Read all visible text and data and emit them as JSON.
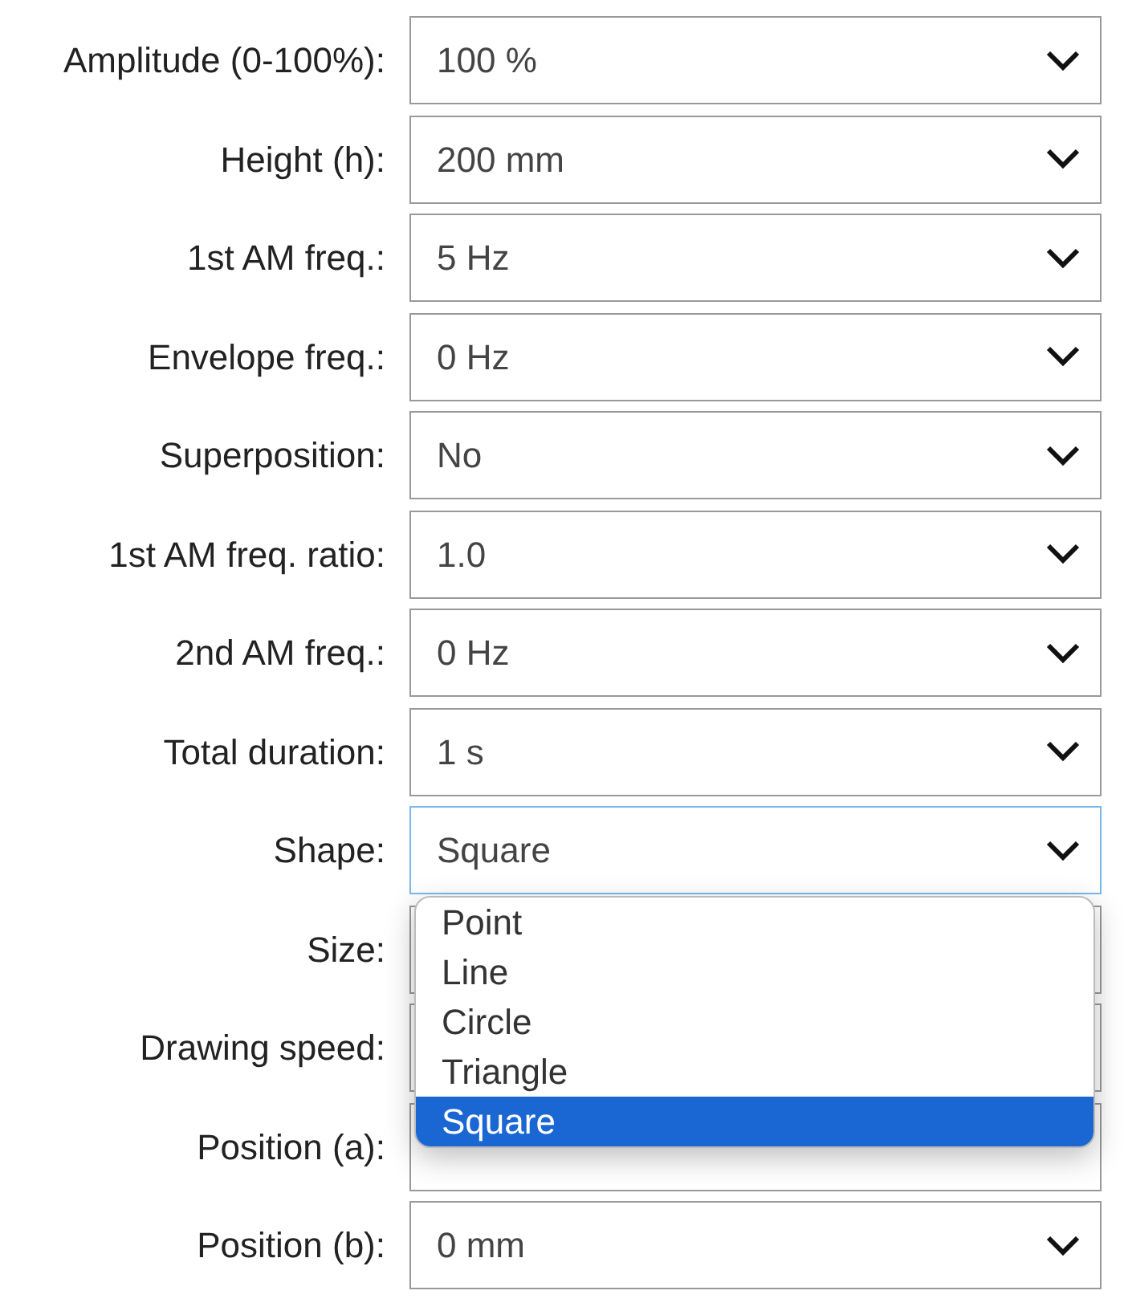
{
  "fields": [
    {
      "label": "Amplitude (0-100%):",
      "value": "100 %",
      "focused": false
    },
    {
      "label": "Height (h):",
      "value": "200 mm",
      "focused": false
    },
    {
      "label": "1st AM freq.:",
      "value": "5 Hz",
      "focused": false
    },
    {
      "label": "Envelope freq.:",
      "value": "0 Hz",
      "focused": false
    },
    {
      "label": "Superposition:",
      "value": "No",
      "focused": false
    },
    {
      "label": "1st AM freq. ratio:",
      "value": "1.0",
      "focused": false
    },
    {
      "label": "2nd AM freq.:",
      "value": "0 Hz",
      "focused": false
    },
    {
      "label": "Total duration:",
      "value": "1 s",
      "focused": false
    },
    {
      "label": "Shape:",
      "value": "Square",
      "focused": true,
      "open_list": [
        {
          "label": "Point",
          "selected": false
        },
        {
          "label": "Line",
          "selected": false
        },
        {
          "label": "Circle",
          "selected": false
        },
        {
          "label": "Triangle",
          "selected": false
        },
        {
          "label": "Square",
          "selected": true
        }
      ]
    },
    {
      "label": "Size:",
      "focused": false
    },
    {
      "label": "Drawing speed:",
      "focused": false
    },
    {
      "label": "Position (a):",
      "focused": false
    },
    {
      "label": "Position (b):",
      "value": "0 mm",
      "focused": false
    }
  ]
}
